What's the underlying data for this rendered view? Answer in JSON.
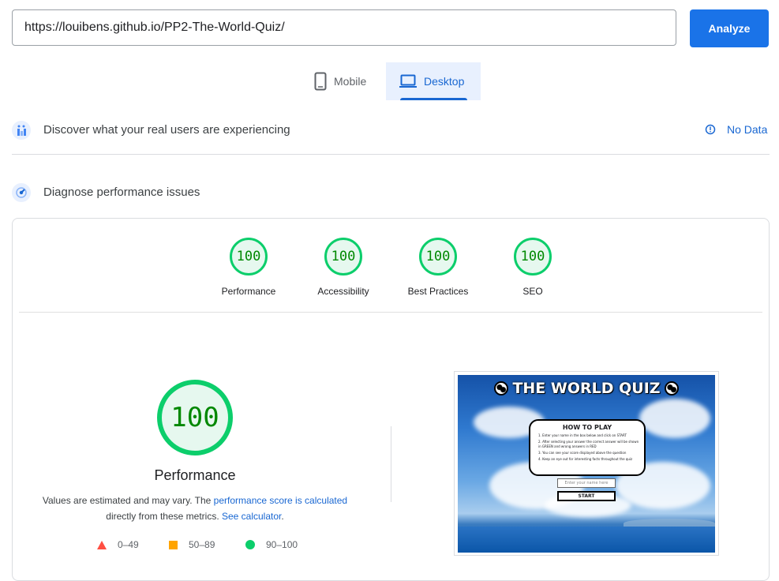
{
  "search": {
    "url_value": "https://louibens.github.io/PP2-The-World-Quiz/",
    "analyze_label": "Analyze"
  },
  "device_tabs": {
    "mobile_label": "Mobile",
    "desktop_label": "Desktop",
    "selected": "Desktop"
  },
  "field_data": {
    "title": "Discover what your real users are experiencing",
    "status_label": "No Data"
  },
  "lab_data": {
    "title": "Diagnose performance issues"
  },
  "category_scores": [
    {
      "score": "100",
      "label": "Performance"
    },
    {
      "score": "100",
      "label": "Accessibility"
    },
    {
      "score": "100",
      "label": "Best Practices"
    },
    {
      "score": "100",
      "label": "SEO"
    }
  ],
  "performance": {
    "score": "100",
    "title": "Performance",
    "desc_part1": "Values are estimated and may vary. The ",
    "desc_link1": "performance score is calculated",
    "desc_part2": " directly from these metrics. ",
    "desc_link2": "See calculator",
    "desc_part3": "."
  },
  "legend": [
    {
      "range": "0–49",
      "shape": "triangle",
      "color": "#ff4e42"
    },
    {
      "range": "50–89",
      "shape": "square",
      "color": "#ffa400"
    },
    {
      "range": "90–100",
      "shape": "circle",
      "color": "#0cce6b"
    }
  ],
  "screenshot": {
    "quiz_title": "THE WORLD QUIZ",
    "how_to_play_title": "HOW TO PLAY",
    "instructions": [
      "1. Enter your name in the box below and click on START",
      "2. After selecting your answer the correct answer will be shown in GREEN and wrong answers in RED",
      "3. You can see your score displayed above the question",
      "4. Keep an eye out for interesting facts throughout the quiz"
    ],
    "name_placeholder": "Enter your name here",
    "start_label": "START"
  },
  "colors": {
    "accent": "#1a73e8",
    "pass_green": "#0cce6b",
    "score_text": "#008800"
  }
}
